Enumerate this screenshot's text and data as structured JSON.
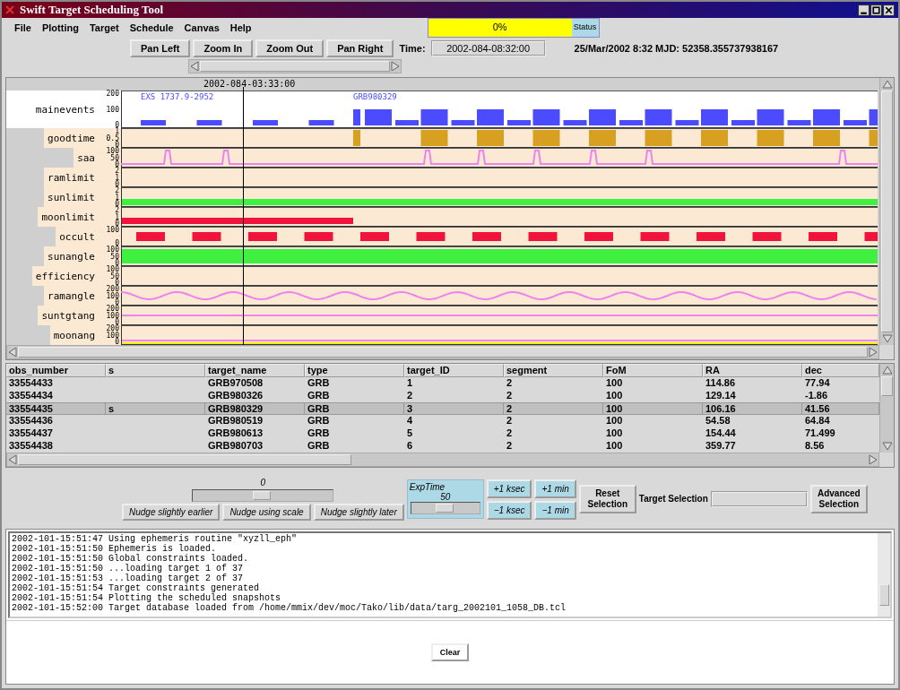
{
  "window": {
    "title": "Swift Target Scheduling Tool"
  },
  "menu": [
    "File",
    "Plotting",
    "Target",
    "Schedule",
    "Canvas",
    "Help"
  ],
  "status": {
    "text": "0%",
    "label": "Status"
  },
  "toolbar": {
    "buttons": [
      "Pan Left",
      "Zoom In",
      "Zoom Out",
      "Pan Right"
    ],
    "time_label": "Time:",
    "time_value": "2002-084-08:32:00",
    "date_info": "25/Mar/2002 8:32  MJD: 52358.355737938167"
  },
  "plot": {
    "cursor_time": "2002-084-03:33:00",
    "tracks": [
      {
        "label": "mainevents",
        "ticks": [
          "200",
          "100",
          "0"
        ],
        "kind": "events",
        "color": "#4b4bff",
        "annotations": [
          "EXS 1737.9-2952",
          "GRB980329"
        ]
      },
      {
        "label": "goodtime",
        "ticks": [
          "1",
          "0.5",
          "0"
        ],
        "kind": "blocks",
        "color": "#d8a020"
      },
      {
        "label": "saa",
        "ticks": [
          "100",
          "50",
          "0"
        ],
        "kind": "pulses",
        "color": "#ee82ee"
      },
      {
        "label": "ramlimit",
        "ticks": [
          "2",
          "1",
          "0"
        ],
        "kind": "empty"
      },
      {
        "label": "sunlimit",
        "ticks": [
          "2",
          "1",
          "0"
        ],
        "kind": "band",
        "color": "#40f040"
      },
      {
        "label": "moonlimit",
        "ticks": [
          "2",
          "1",
          "0"
        ],
        "kind": "partial-band",
        "color": "#f0143c"
      },
      {
        "label": "occult",
        "ticks": [
          "100",
          "0"
        ],
        "kind": "periodic-blocks",
        "color": "#f0143c"
      },
      {
        "label": "sunangle",
        "ticks": [
          "100",
          "50",
          "0"
        ],
        "kind": "fill",
        "color": "#40f040"
      },
      {
        "label": "efficiency",
        "ticks": [
          "100",
          "50",
          "0"
        ],
        "kind": "empty"
      },
      {
        "label": "ramangle",
        "ticks": [
          "200",
          "100",
          "0"
        ],
        "kind": "wave",
        "color": "#ee82ee"
      },
      {
        "label": "suntgtang",
        "ticks": [
          "200",
          "100",
          "0"
        ],
        "kind": "flat",
        "color": "#ee82ee"
      },
      {
        "label": "moonang",
        "ticks": [
          "200",
          "100",
          "0"
        ],
        "kind": "flat-low",
        "color": "#ee82ee"
      }
    ]
  },
  "table": {
    "columns": [
      "obs_number",
      "s",
      "target_name",
      "type",
      "target_ID",
      "segment",
      "FoM",
      "RA",
      "dec"
    ],
    "rows": [
      {
        "selected": false,
        "cells": [
          "33554433",
          "",
          "GRB970508",
          "GRB",
          "1",
          "2",
          "100",
          "114.86",
          "77.94"
        ]
      },
      {
        "selected": false,
        "cells": [
          "33554434",
          "",
          "GRB980326",
          "GRB",
          "2",
          "2",
          "100",
          "129.14",
          "-1.86"
        ]
      },
      {
        "selected": true,
        "cells": [
          "33554435",
          "s",
          "GRB980329",
          "GRB",
          "3",
          "2",
          "100",
          "106.16",
          "41.56"
        ]
      },
      {
        "selected": false,
        "cells": [
          "33554436",
          "",
          "GRB980519",
          "GRB",
          "4",
          "2",
          "100",
          "54.58",
          "64.84"
        ]
      },
      {
        "selected": false,
        "cells": [
          "33554437",
          "",
          "GRB980613",
          "GRB",
          "5",
          "2",
          "100",
          "154.44",
          "71.499"
        ]
      },
      {
        "selected": false,
        "cells": [
          "33554438",
          "",
          "GRB980703",
          "GRB",
          "6",
          "2",
          "100",
          "359.77",
          "8.56"
        ]
      }
    ]
  },
  "nudge": {
    "value": "0",
    "level": 0.5,
    "buttons": [
      "Nudge slightly earlier",
      "Nudge using scale",
      "Nudge slightly later"
    ]
  },
  "exptime": {
    "label": "ExpTime",
    "value": "50",
    "level": 0.5,
    "buttons": [
      "+1 ksec",
      "+1 min",
      "−1 ksec",
      "−1 min"
    ]
  },
  "selection": {
    "reset": "Reset Selection",
    "target_label": "Target Selection",
    "advanced": "Advanced Selection"
  },
  "log": [
    "2002-101-15:51:47 Using ephemeris routine \"xyzll_eph\"",
    "2002-101-15:51:50 Ephemeris is loaded.",
    "2002-101-15:51:50 Global constraints loaded.",
    "2002-101-15:51:50 ...loading target 1 of 37",
    "2002-101-15:51:53 ...loading target 2 of 37",
    "2002-101-15:51:54 Target constraints generated",
    "2002-101-15:51:54 Plotting the scheduled snapshots",
    "2002-101-15:52:00 Target database loaded from /home/mmix/dev/moc/Tako/lib/data/targ_2002101_1058_DB.tcl"
  ],
  "clear_button": "Clear"
}
